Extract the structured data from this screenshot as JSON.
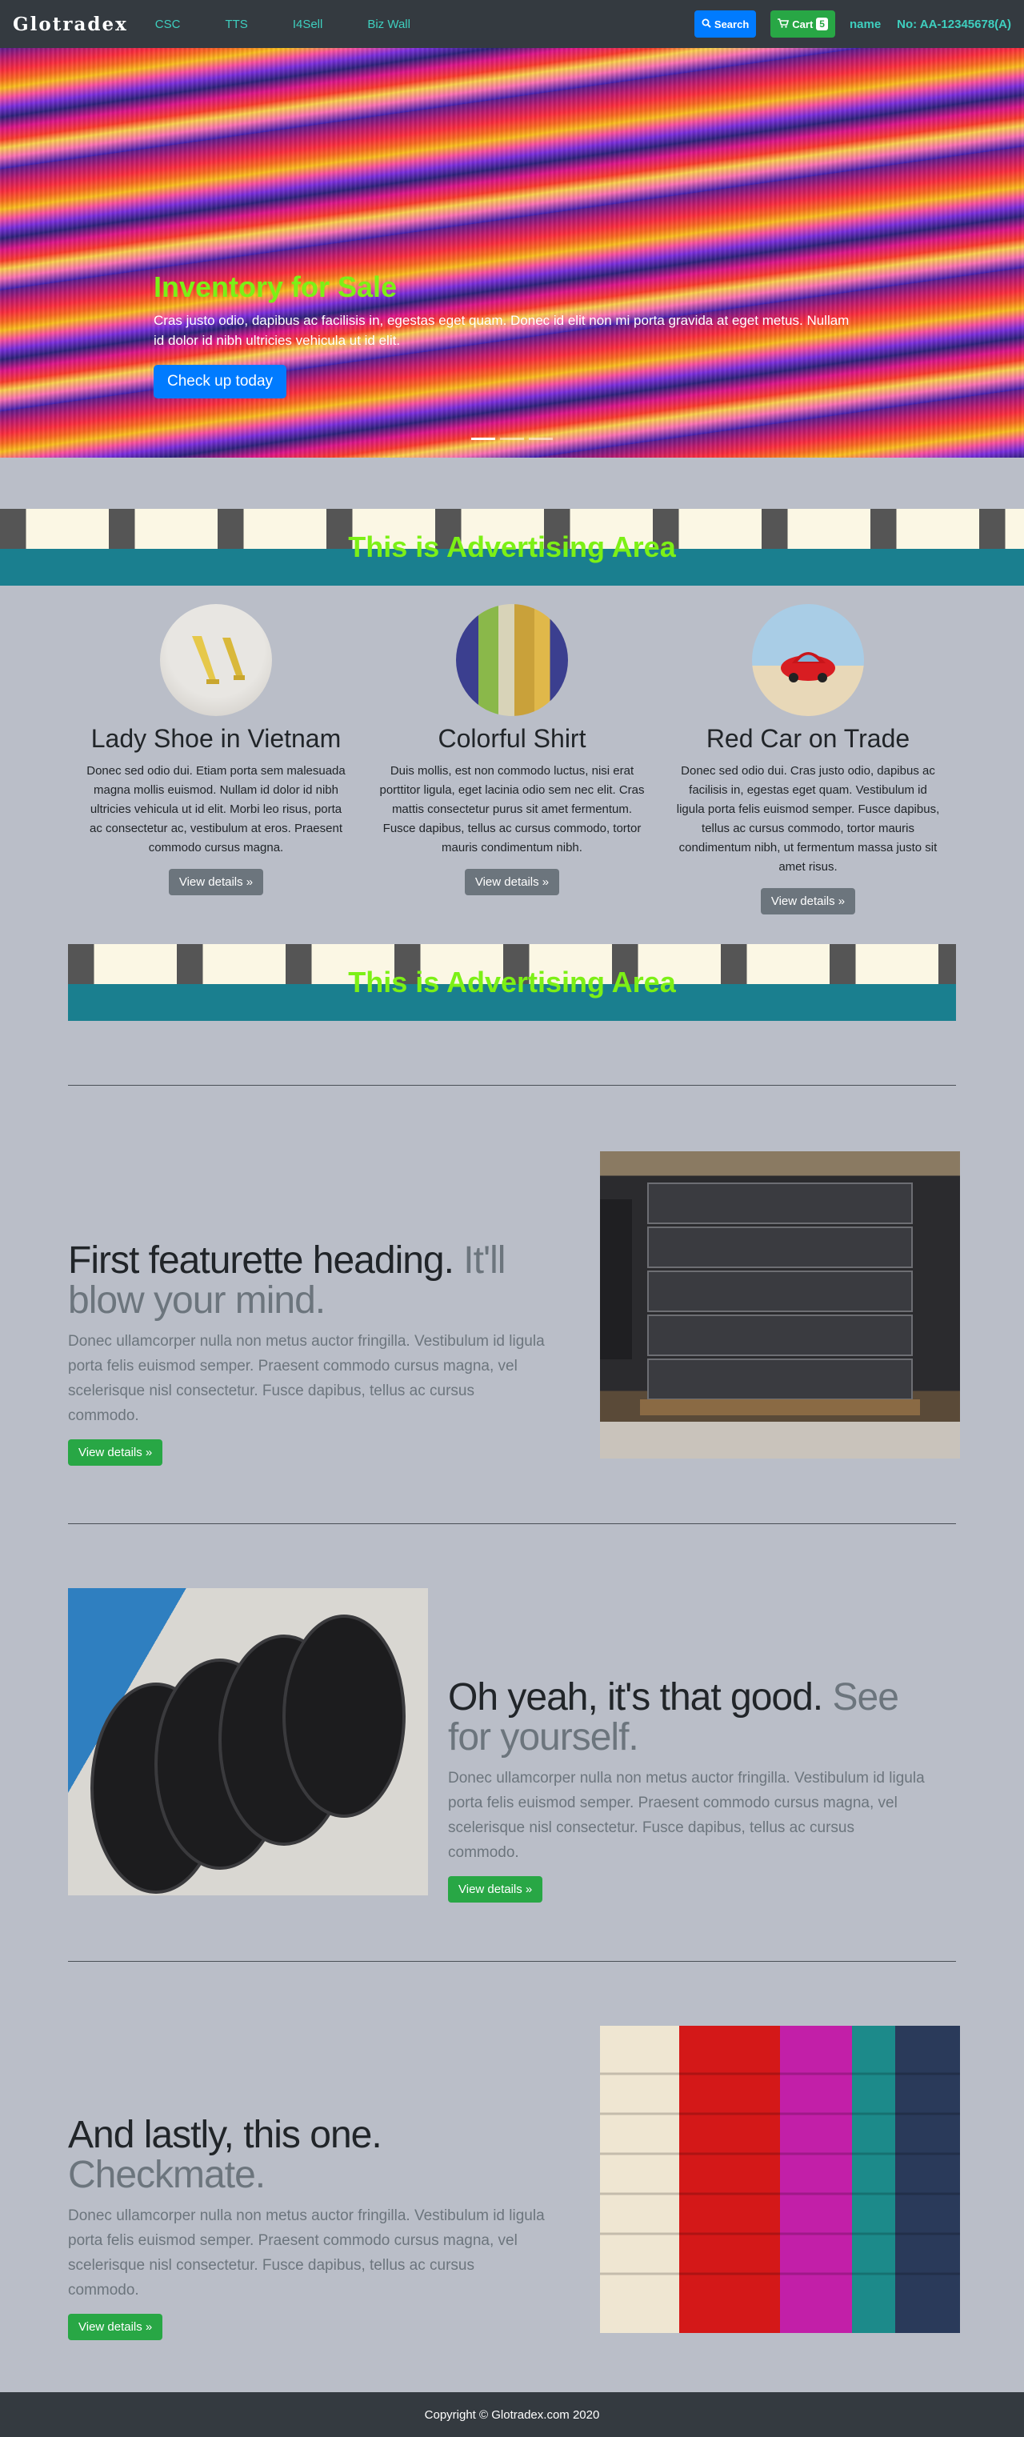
{
  "nav": {
    "brand": "Glotradex",
    "links": [
      "CSC",
      "TTS",
      "I4Sell",
      "Biz Wall"
    ],
    "search_label": "Search",
    "cart_label": "Cart",
    "cart_count": "5",
    "user_name": "name",
    "account_no": "No: AA-12345678(A)"
  },
  "hero": {
    "title": "Inventory for Sale",
    "text": "Cras justo odio, dapibus ac facilisis in, egestas eget quam. Donec id elit non mi porta gravida at eget metus. Nullam id dolor id nibh ultricies vehicula ut id elit.",
    "button": "Check up today"
  },
  "ads": {
    "top": "This is Advertising Area",
    "bottom": "This is Advertising Area"
  },
  "products": [
    {
      "title": "Lady Shoe in Vietnam",
      "desc": "Donec sed odio dui. Etiam porta sem malesuada magna mollis euismod. Nullam id dolor id nibh ultricies vehicula ut id elit. Morbi leo risus, porta ac consectetur ac, vestibulum at eros. Praesent commodo cursus magna.",
      "button": "View details »"
    },
    {
      "title": "Colorful Shirt",
      "desc": "Duis mollis, est non commodo luctus, nisi erat porttitor ligula, eget lacinia odio sem nec elit. Cras mattis consectetur purus sit amet fermentum. Fusce dapibus, tellus ac cursus commodo, tortor mauris condimentum nibh.",
      "button": "View details »"
    },
    {
      "title": "Red Car on Trade",
      "desc": "Donec sed odio dui. Cras justo odio, dapibus ac facilisis in, egestas eget quam. Vestibulum id ligula porta felis euismod semper. Fusce dapibus, tellus ac cursus commodo, tortor mauris condimentum nibh, ut fermentum massa justo sit amet risus.",
      "button": "View details »"
    }
  ],
  "featurettes": [
    {
      "heading": "First featurette heading.",
      "muted": "It'll blow your mind.",
      "lead": "Donec ullamcorper nulla non metus auctor fringilla. Vestibulum id ligula porta felis euismod semper. Praesent commodo cursus magna, vel scelerisque nisl consectetur. Fusce dapibus, tellus ac cursus commodo.",
      "button": "View details »"
    },
    {
      "heading": "Oh yeah, it's that good.",
      "muted": "See for yourself.",
      "lead": "Donec ullamcorper nulla non metus auctor fringilla. Vestibulum id ligula porta felis euismod semper. Praesent commodo cursus magna, vel scelerisque nisl consectetur. Fusce dapibus, tellus ac cursus commodo.",
      "button": "View details »"
    },
    {
      "heading": "And lastly, this one.",
      "muted": "Checkmate.",
      "lead": "Donec ullamcorper nulla non metus auctor fringilla. Vestibulum id ligula porta felis euismod semper. Praesent commodo cursus magna, vel scelerisque nisl consectetur. Fusce dapibus, tellus ac cursus commodo.",
      "button": "View details »"
    }
  ],
  "footer": "Copyright © Glotradex.com 2020"
}
